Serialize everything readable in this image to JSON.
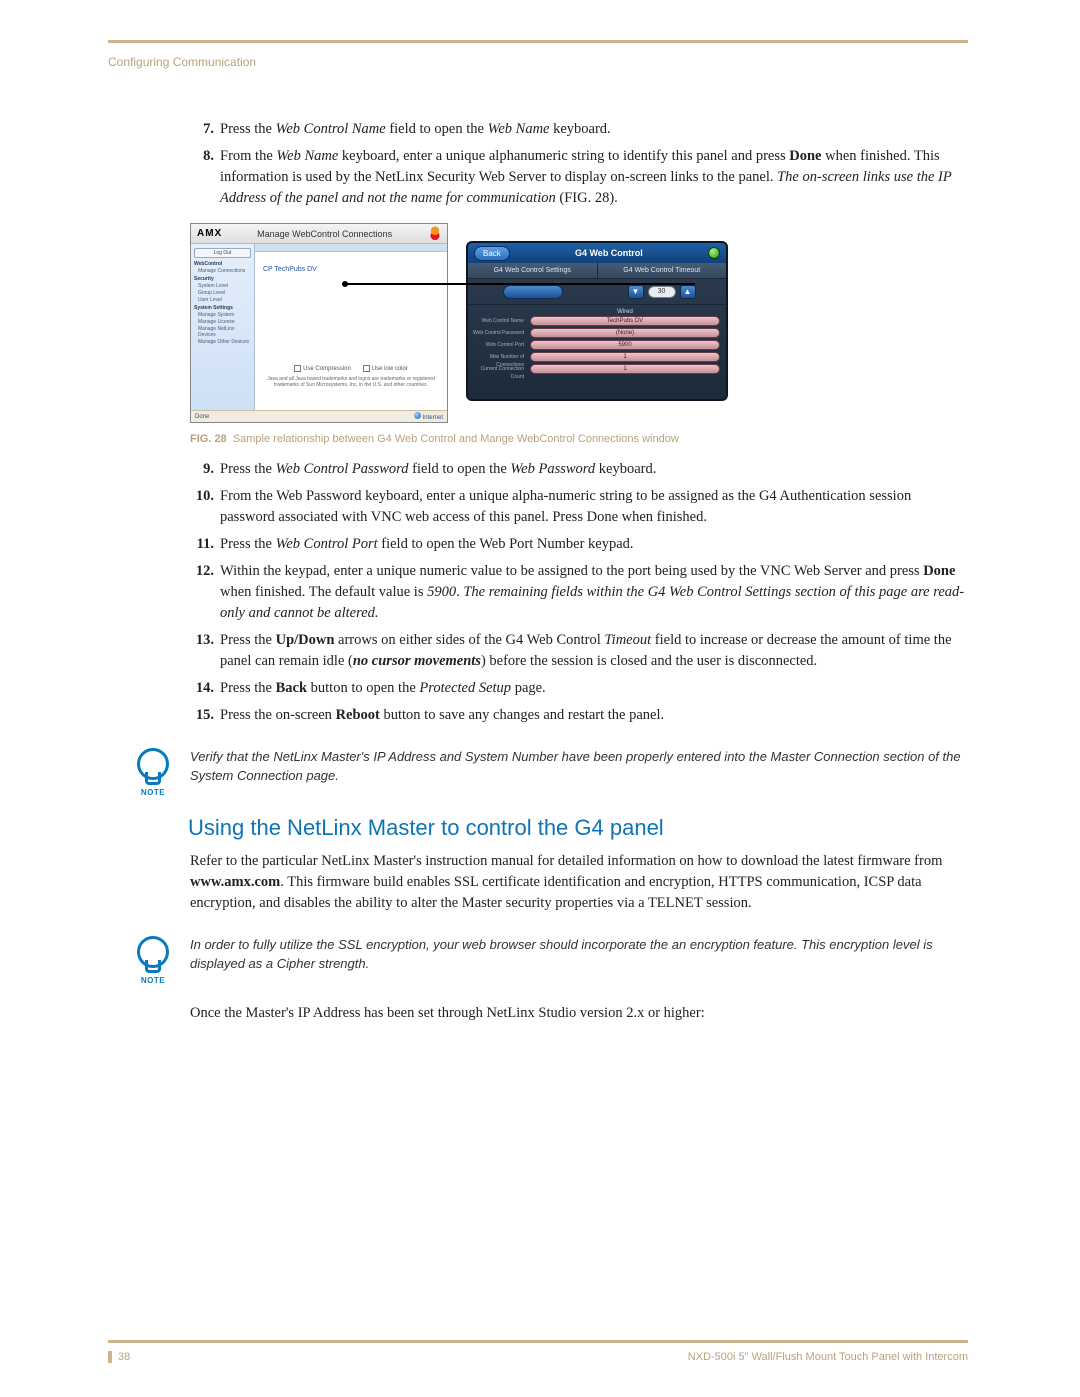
{
  "header": {
    "breadcrumb": "Configuring Communication"
  },
  "steps_a": [
    {
      "n": "7.",
      "html": "Press the <em class='i'>Web Control Name</em> field to open the <em class='i'>Web Name</em> keyboard."
    },
    {
      "n": "8.",
      "html": "From the <em class='i'>Web Name</em> keyboard, enter a unique alphanumeric string to identify this panel and press <strong class='b'>Done</strong> when finished. This information is used by the NetLinx Security Web Server to display on-screen links to the panel. <em class='i'>The on-screen links use the IP Address of the panel and not the name for communication</em> (FIG. 28)."
    }
  ],
  "figure": {
    "left": {
      "logo": "AMX",
      "title": "Manage WebControl Connections",
      "sidebar": {
        "login_btn": "Log Out",
        "groups": [
          {
            "head": "WebControl",
            "items": [
              "Manage Connections"
            ]
          },
          {
            "head": "Security",
            "items": [
              "System Level",
              "Group Level",
              "User Level"
            ]
          },
          {
            "head": "System Settings",
            "items": [
              "Manage System",
              "Manage License",
              "Manage NetLinx Devices",
              "Manage Other Devices"
            ]
          }
        ]
      },
      "link": "CP TechPubs DV",
      "checks": [
        "Use Compression",
        "Use low color"
      ],
      "fineprint": "Java and all Java based trademarks and logos are trademarks or registered trademarks of Sun Microsystems, Inc. in the U.S. and other countries.",
      "status_left": "Done",
      "status_right": "Internet"
    },
    "right": {
      "back": "Back",
      "title": "G4 Web Control",
      "sub_l": "G4 Web Control Settings",
      "sub_r": "G4 Web Control Timeout",
      "timeout": "30",
      "row_head": "Wired",
      "row_labels": [
        "Web Control Name",
        "Web Control Password",
        "Web Control Port",
        "Max Number of Connections",
        "Current Connection Count"
      ],
      "row_values": [
        "TechPubs DV",
        "(None)",
        "5900",
        "1",
        "1"
      ]
    },
    "caption_label": "FIG. 28",
    "caption_text": "Sample relationship between G4 Web Control and Mange WebControl Connections window"
  },
  "steps_b": [
    {
      "n": "9.",
      "html": "Press the <em class='i'>Web Control Password</em> field to open the <em class='i'>Web Password</em> keyboard."
    },
    {
      "n": "10.",
      "html": "From the Web Password keyboard, enter a unique alpha-numeric string to be assigned as the G4 Authentication session password associated with VNC web access of this panel. Press Done when finished."
    },
    {
      "n": "11.",
      "html": "Press the <em class='i'>Web Control Port</em> field to open the Web Port Number keypad."
    },
    {
      "n": "12.",
      "html": "Within the keypad, enter a unique numeric value to be assigned to the port being used by the VNC Web Server and press <strong class='b'>Done</strong> when finished. The default value is <em class='i'>5900</em>. <em class='i'>The remaining fields within the G4 Web Control Settings section of this page are read-only and cannot be altered.</em>"
    },
    {
      "n": "13.",
      "html": "Press the <strong class='b'>Up/Down</strong> arrows on either sides of the G4 Web Control <em class='i'>Timeout</em> field to increase or decrease the amount of time the panel can remain idle (<strong class='b'><em class='i'>no cursor movements</em></strong>) before the session is closed and the user is disconnected."
    },
    {
      "n": "14.",
      "html": "Press the <strong class='b'>Back</strong> button to open the <em class='i'>Protected Setup</em> page."
    },
    {
      "n": "15.",
      "html": "Press the on-screen <strong class='b'>Reboot</strong> button to save any changes and restart the panel."
    }
  ],
  "note1": "Verify that the NetLinx Master's IP Address and System Number have been properly entered into the Master Connection section of the System Connection page.",
  "note_label": "NOTE",
  "section_heading": "Using the NetLinx Master to control the G4 panel",
  "section_para": "Refer to the particular NetLinx Master's instruction manual for detailed information on how to download the latest firmware from <strong class='b'>www.amx.com</strong>. This firmware build enables SSL certificate identification and encryption, HTTPS communication, ICSP data encryption, and disables the ability to alter the Master security properties via a TELNET session.",
  "note2": "In order to fully utilize the SSL encryption, your web browser should incorporate the an encryption feature. This encryption level is displayed as a Cipher strength.",
  "closing_para": "Once the Master's IP Address has been set through NetLinx Studio version 2.x or higher:",
  "footer": {
    "page": "38",
    "product": "NXD-500i 5\" Wall/Flush Mount Touch Panel with Intercom"
  }
}
